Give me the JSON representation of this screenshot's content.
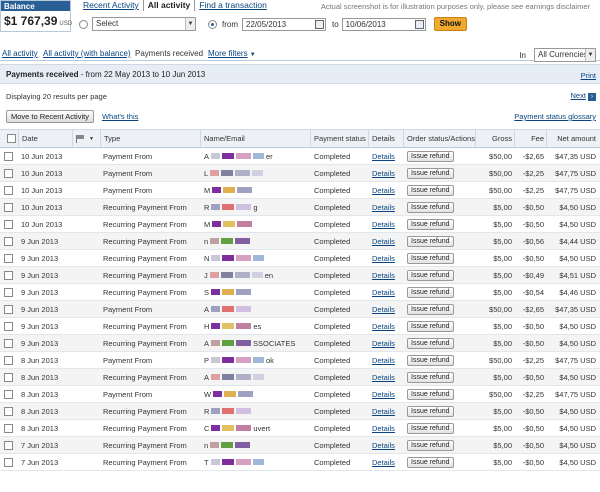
{
  "balance": {
    "label": "Balance",
    "amount": "$1 767,39",
    "currency": "USD"
  },
  "top_tabs": [
    {
      "label": "Recent Activity",
      "active": false
    },
    {
      "label": "All activity",
      "active": true
    },
    {
      "label": "Find a transaction",
      "active": false
    }
  ],
  "disclaimer": "Actual screenshot is for illustration purposes only, please see earnings disclaimer",
  "filters": {
    "select_value": "Select",
    "from_label": "from",
    "from_date": "22/05/2013",
    "to_label": "to",
    "to_date": "10/06/2013",
    "show_label": "Show"
  },
  "sub_tabs": [
    {
      "label": "All activity",
      "link": true
    },
    {
      "label": "All activity (with balance)",
      "link": true
    },
    {
      "label": "Payments received",
      "link": false
    },
    {
      "label": "More filters",
      "link": true
    }
  ],
  "currency_filter": {
    "label": "In",
    "value": "All Currencies"
  },
  "heading": {
    "title": "Payments received",
    "range": "- from 22 May 2013 to 10 Jun 2013",
    "print": "Print"
  },
  "results_text": "Displaying 20 results per page",
  "next_label": "Next",
  "move_button": "Move to Recent Activity",
  "whats_this": "What's this",
  "glossary": "Payment status glossary",
  "columns": {
    "date": "Date",
    "type": "Type",
    "name": "Name/Email",
    "status": "Payment status",
    "details": "Details",
    "order": "Order status/Actions",
    "gross": "Gross",
    "fee": "Fee",
    "net": "Net amount"
  },
  "colors": {
    "accent": "#2a5f95",
    "show_button": "#f0a830",
    "link": "#084482"
  },
  "rows": [
    {
      "date": "10 Jun 2013",
      "type": "Payment From",
      "name": "A",
      "name_end": "er",
      "status": "Completed",
      "details": "Details",
      "action": "Issue refund",
      "gross": "$50,00",
      "fee": "-$2,65",
      "net": "$47,35 USD"
    },
    {
      "date": "10 Jun 2013",
      "type": "Payment From",
      "name": "L",
      "name_end": "",
      "status": "Completed",
      "details": "Details",
      "action": "Issue refund",
      "gross": "$50,00",
      "fee": "-$2,25",
      "net": "$47,75 USD"
    },
    {
      "date": "10 Jun 2013",
      "type": "Payment From",
      "name": "M",
      "name_end": "",
      "status": "Completed",
      "details": "Details",
      "action": "Issue refund",
      "gross": "$50,00",
      "fee": "-$2,25",
      "net": "$47,75 USD"
    },
    {
      "date": "10 Jun 2013",
      "type": "Recurring Payment From",
      "name": "R",
      "name_end": "g",
      "status": "Completed",
      "details": "Details",
      "action": "Issue refund",
      "gross": "$5,00",
      "fee": "-$0,50",
      "net": "$4,50 USD"
    },
    {
      "date": "10 Jun 2013",
      "type": "Recurring Payment From",
      "name": "M",
      "name_end": "",
      "status": "Completed",
      "details": "Details",
      "action": "Issue refund",
      "gross": "$5,00",
      "fee": "-$0,50",
      "net": "$4,50 USD"
    },
    {
      "date": "9 Jun 2013",
      "type": "Recurring Payment From",
      "name": "n",
      "name_end": "",
      "status": "Completed",
      "details": "Details",
      "action": "Issue refund",
      "gross": "$5,00",
      "fee": "-$0,56",
      "net": "$4,44 USD"
    },
    {
      "date": "9 Jun 2013",
      "type": "Recurring Payment From",
      "name": "N",
      "name_end": "",
      "status": "Completed",
      "details": "Details",
      "action": "Issue refund",
      "gross": "$5,00",
      "fee": "-$0,50",
      "net": "$4,50 USD"
    },
    {
      "date": "9 Jun 2013",
      "type": "Recurring Payment From",
      "name": "J",
      "name_end": "en",
      "status": "Completed",
      "details": "Details",
      "action": "Issue refund",
      "gross": "$5,00",
      "fee": "-$0,49",
      "net": "$4,51 USD"
    },
    {
      "date": "9 Jun 2013",
      "type": "Recurring Payment From",
      "name": "S",
      "name_end": "",
      "status": "Completed",
      "details": "Details",
      "action": "Issue refund",
      "gross": "$5,00",
      "fee": "-$0,54",
      "net": "$4,46 USD"
    },
    {
      "date": "9 Jun 2013",
      "type": "Payment From",
      "name": "A",
      "name_end": "",
      "status": "Completed",
      "details": "Details",
      "action": "Issue refund",
      "gross": "$50,00",
      "fee": "-$2,65",
      "net": "$47,35 USD"
    },
    {
      "date": "9 Jun 2013",
      "type": "Recurring Payment From",
      "name": "H",
      "name_end": "es",
      "status": "Completed",
      "details": "Details",
      "action": "Issue refund",
      "gross": "$5,00",
      "fee": "-$0,50",
      "net": "$4,50 USD"
    },
    {
      "date": "9 Jun 2013",
      "type": "Recurring Payment From",
      "name": "A",
      "name_end": "SSOCIATES",
      "status": "Completed",
      "details": "Details",
      "action": "Issue refund",
      "gross": "$5,00",
      "fee": "-$0,50",
      "net": "$4,50 USD"
    },
    {
      "date": "8 Jun 2013",
      "type": "Payment From",
      "name": "P",
      "name_end": "ok",
      "status": "Completed",
      "details": "Details",
      "action": "Issue refund",
      "gross": "$50,00",
      "fee": "-$2,25",
      "net": "$47,75 USD"
    },
    {
      "date": "8 Jun 2013",
      "type": "Recurring Payment From",
      "name": "A",
      "name_end": "",
      "status": "Completed",
      "details": "Details",
      "action": "Issue refund",
      "gross": "$5,00",
      "fee": "-$0,50",
      "net": "$4,50 USD"
    },
    {
      "date": "8 Jun 2013",
      "type": "Payment From",
      "name": "W",
      "name_end": "",
      "status": "Completed",
      "details": "Details",
      "action": "Issue refund",
      "gross": "$50,00",
      "fee": "-$2,25",
      "net": "$47,75 USD"
    },
    {
      "date": "8 Jun 2013",
      "type": "Recurring Payment From",
      "name": "R",
      "name_end": "",
      "status": "Completed",
      "details": "Details",
      "action": "Issue refund",
      "gross": "$5,00",
      "fee": "-$0,50",
      "net": "$4,50 USD"
    },
    {
      "date": "8 Jun 2013",
      "type": "Recurring Payment From",
      "name": "C",
      "name_end": "uvert",
      "status": "Completed",
      "details": "Details",
      "action": "Issue refund",
      "gross": "$5,00",
      "fee": "-$0,50",
      "net": "$4,50 USD"
    },
    {
      "date": "7 Jun 2013",
      "type": "Recurring Payment From",
      "name": "n",
      "name_end": "",
      "status": "Completed",
      "details": "Details",
      "action": "Issue refund",
      "gross": "$5,00",
      "fee": "-$0,50",
      "net": "$4,50 USD"
    },
    {
      "date": "7 Jun 2013",
      "type": "Recurring Payment From",
      "name": "T",
      "name_end": "",
      "status": "Completed",
      "details": "Details",
      "action": "Issue refund",
      "gross": "$5,00",
      "fee": "-$0,50",
      "net": "$4,50 USD"
    }
  ]
}
